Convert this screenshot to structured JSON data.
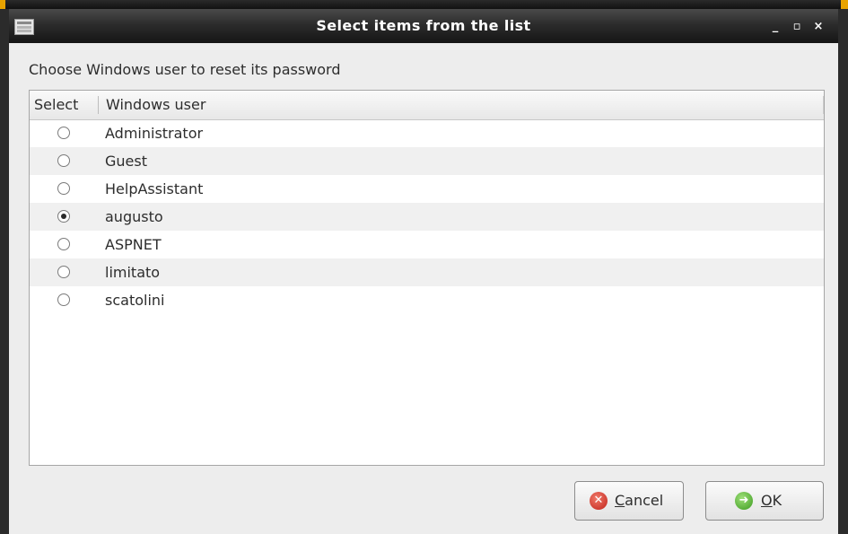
{
  "window": {
    "title": "Select items from the list",
    "controls": {
      "minimize": "_",
      "maximize": "▫",
      "close": "×"
    },
    "icon": "list-window-icon"
  },
  "prompt": "Choose Windows user to reset its password",
  "list": {
    "columns": {
      "select": "Select",
      "user": "Windows user"
    },
    "rows": [
      {
        "label": "Administrator",
        "selected": false
      },
      {
        "label": "Guest",
        "selected": false
      },
      {
        "label": "HelpAssistant",
        "selected": false
      },
      {
        "label": "augusto",
        "selected": true
      },
      {
        "label": "ASPNET",
        "selected": false
      },
      {
        "label": "limitato",
        "selected": false
      },
      {
        "label": "scatolini",
        "selected": false
      }
    ]
  },
  "buttons": {
    "cancel": {
      "mnemonic": "C",
      "rest": "ancel",
      "icon": "cancel-icon",
      "glyph": "✕"
    },
    "ok": {
      "mnemonic": "O",
      "rest": "K",
      "icon": "ok-arrow-icon",
      "glyph": "➜"
    }
  },
  "colors": {
    "titlebar": "#2c2c2c",
    "window_bg": "#ededed",
    "cancel_icon": "#c0231b",
    "ok_icon": "#3b9a1e"
  }
}
